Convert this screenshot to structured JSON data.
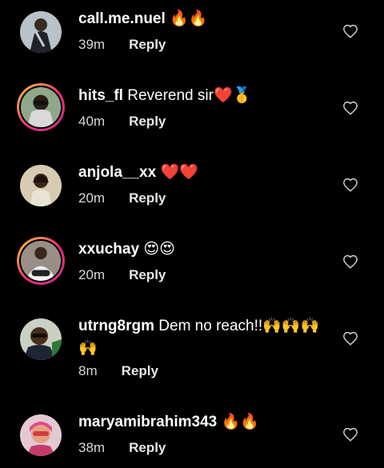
{
  "comments": [
    {
      "username": "call.me.nuel",
      "text": " 🔥🔥",
      "time": "39m",
      "reply_label": "Reply"
    },
    {
      "username": "hits_fl",
      "text": " Reverend sir❤️🥇",
      "time": "40m",
      "reply_label": "Reply"
    },
    {
      "username": "anjola__xx",
      "text": " ❤️❤️",
      "time": "20m",
      "reply_label": "Reply"
    },
    {
      "username": "xxuchay",
      "text": " 😍😍",
      "time": "20m",
      "reply_label": "Reply"
    },
    {
      "username": "utrng8rgm",
      "text": " Dem no reach!!🙌🙌🙌 🙌",
      "time": "8m",
      "reply_label": "Reply"
    },
    {
      "username": "maryamibrahim343",
      "text": " 🔥🔥",
      "time": "38m",
      "reply_label": "Reply"
    }
  ],
  "icons": {
    "like": "heart-outline-icon"
  },
  "colors": {
    "background": "#000000",
    "text": "#ffffff",
    "meta": "#d8d8d8",
    "story_ring_start": "#f9ce34",
    "story_ring_end": "#c13584"
  }
}
